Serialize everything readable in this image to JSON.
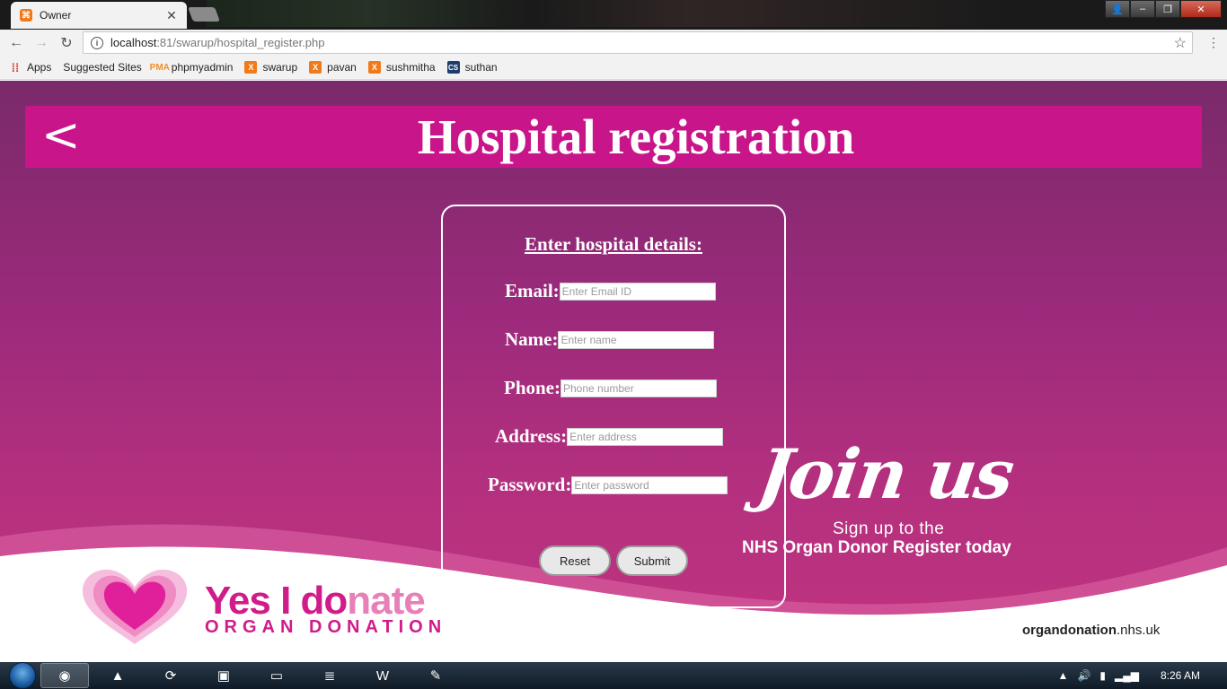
{
  "browser": {
    "tab": {
      "title": "Owner",
      "close": "✕"
    },
    "window_buttons": {
      "user": "👤",
      "minimize": "–",
      "maximize": "❐",
      "close": "✕"
    },
    "nav": {
      "back": "←",
      "forward": "→",
      "reload": "↻"
    },
    "url": {
      "host": "localhost",
      "path": ":81/swarup/hospital_register.php"
    },
    "star": "☆",
    "menu": "⋮"
  },
  "bookmarks": [
    {
      "label": "Apps",
      "icon": "apps-grid-icon",
      "glyph": "⁞⁞"
    },
    {
      "label": "Suggested Sites",
      "icon": "page-icon",
      "glyph": ""
    },
    {
      "label": "phpmyadmin",
      "icon": "phpmyadmin-icon",
      "glyph": "PMA"
    },
    {
      "label": "swarup",
      "icon": "xampp-icon",
      "glyph": "X"
    },
    {
      "label": "pavan",
      "icon": "xampp-icon",
      "glyph": "X"
    },
    {
      "label": "sushmitha",
      "icon": "xampp-icon",
      "glyph": "X"
    },
    {
      "label": "suthan",
      "icon": "cs-icon",
      "glyph": "CS"
    }
  ],
  "page": {
    "back_symbol": "<",
    "title": "Hospital registration",
    "form": {
      "heading": "Enter hospital details:",
      "fields": [
        {
          "label": "Email:",
          "placeholder": "Enter Email ID",
          "value": ""
        },
        {
          "label": "Name:",
          "placeholder": "Enter name",
          "value": ""
        },
        {
          "label": "Phone:",
          "placeholder": "Phone number",
          "value": ""
        },
        {
          "label": "Address:",
          "placeholder": "Enter address",
          "value": ""
        },
        {
          "label": "Password:",
          "placeholder": "Enter password",
          "value": ""
        }
      ],
      "reset_label": "Reset",
      "submit_label": "Submit"
    },
    "banner": {
      "join": "Join us",
      "line1": "Sign up to the",
      "line2": "NHS Organ Donor Register today",
      "logo_part1": "Yes I do",
      "logo_part2": "nate",
      "logo_sub": "ORGAN DONATION",
      "site_bold": "organdonation",
      "site_rest": ".nhs.uk"
    },
    "colors": {
      "header": "#c8158a",
      "background_top": "#7a2a6a",
      "background_bottom": "#c03480",
      "logo_pink": "#d01c8a"
    }
  },
  "taskbar": {
    "items": [
      {
        "name": "chrome-icon",
        "glyph": "◉",
        "active": true
      },
      {
        "name": "vlc-icon",
        "glyph": "▲",
        "active": false
      },
      {
        "name": "teamviewer-icon",
        "glyph": "⟳",
        "active": false
      },
      {
        "name": "remote-desktop-icon",
        "glyph": "▣",
        "active": false
      },
      {
        "name": "file-explorer-icon",
        "glyph": "▭",
        "active": false
      },
      {
        "name": "notepad-icon",
        "glyph": "≣",
        "active": false
      },
      {
        "name": "word-icon",
        "glyph": "W",
        "active": false
      },
      {
        "name": "paint-icon",
        "glyph": "✎",
        "active": false
      }
    ],
    "tray": {
      "arrow": "▲",
      "volume": "🔊",
      "network": "▮",
      "signal": "▂▄▆",
      "time": "8:26 AM"
    }
  }
}
